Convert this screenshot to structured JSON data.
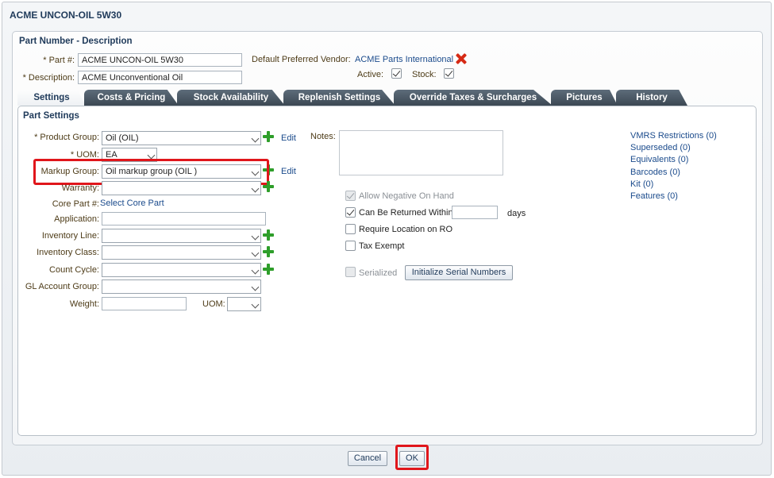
{
  "window": {
    "title": "ACME UNCON-OIL 5W30"
  },
  "header": {
    "section_title": "Part Number - Description",
    "part_label": "Part #:",
    "part_value": "ACME UNCON-OIL 5W30",
    "description_label": "Description:",
    "description_value": "ACME Unconventional Oil",
    "vendor_label": "Default Preferred Vendor:",
    "vendor_value": "ACME Parts International",
    "active_label": "Active:",
    "active_checked": true,
    "stock_label": "Stock:",
    "stock_checked": true
  },
  "tabs": [
    {
      "label": "Settings",
      "active": true
    },
    {
      "label": "Costs & Pricing"
    },
    {
      "label": "Stock Availability"
    },
    {
      "label": "Replenish Settings"
    },
    {
      "label": "Override Taxes & Surcharges"
    },
    {
      "label": "Pictures"
    },
    {
      "label": "History"
    }
  ],
  "settings": {
    "section_title": "Part Settings",
    "product_group_label": "Product Group:",
    "product_group_value": "Oil (OIL)",
    "uom_label": "UOM:",
    "uom_value": "EA",
    "markup_group_label": "Markup Group:",
    "markup_group_value": "Oil markup group (OIL )",
    "warranty_label": "Warranty:",
    "core_part_label": "Core Part #:",
    "core_part_link": "Select Core Part",
    "application_label": "Application:",
    "inventory_line_label": "Inventory Line:",
    "inventory_class_label": "Inventory Class:",
    "count_cycle_label": "Count Cycle:",
    "gl_account_group_label": "GL Account Group:",
    "weight_label": "Weight:",
    "weight_uom_label": "UOM:",
    "edit_label": "Edit",
    "notes_label": "Notes:",
    "allow_negative_label": "Allow Negative On Hand",
    "can_be_returned_label": "Can Be Returned Within",
    "days_label": "days",
    "require_location_label": "Require Location on RO",
    "tax_exempt_label": "Tax Exempt",
    "serialized_label": "Serialized",
    "init_serial_button": "Initialize Serial Numbers",
    "links": [
      "VMRS Restrictions (0)",
      "Superseded (0)",
      "Equivalents (0)",
      "Barcodes (0)",
      "Kit (0)",
      "Features (0)"
    ]
  },
  "footer": {
    "cancel": "Cancel",
    "ok": "OK"
  },
  "colors": {
    "highlight": "#e0161b",
    "link": "#1b4b8c",
    "label": "#4d3b17",
    "tab_dark": "#3c4853"
  }
}
